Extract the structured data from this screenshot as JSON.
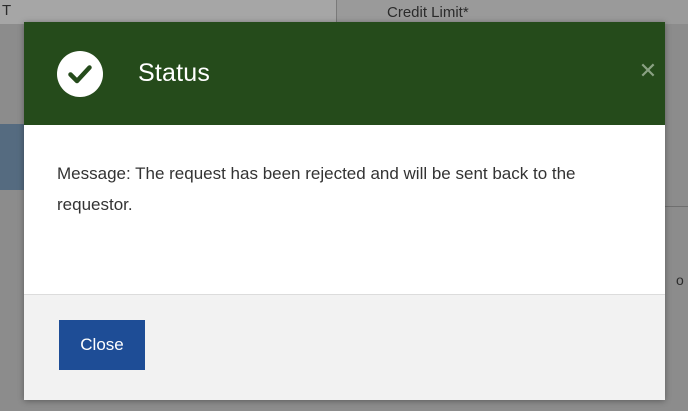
{
  "background": {
    "left_label_fragment": "T",
    "credit_limit_label": "Credit Limit*",
    "right_text_fragment": "o"
  },
  "modal": {
    "title": "Status",
    "close_icon": "close-icon",
    "status_icon": "check-circle-icon",
    "message": "Message: The request has been rejected and will be sent back to the requestor.",
    "close_button_label": "Close"
  },
  "colors": {
    "header_bg": "#254b1b",
    "button_bg": "#1e4d96",
    "footer_bg": "#f2f2f2"
  }
}
